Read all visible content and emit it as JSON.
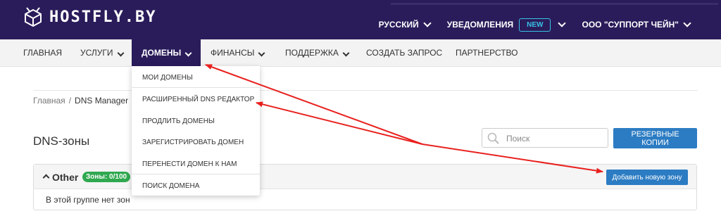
{
  "header": {
    "logo_text": "HOSTFLY.BY",
    "language": "РУССКИЙ",
    "notifications": "УВЕДОМЛЕНИЯ",
    "new_badge": "NEW",
    "account": "ООО \"СУППОРТ ЧЕЙН\""
  },
  "nav": {
    "items": [
      {
        "label": "ГЛАВНАЯ"
      },
      {
        "label": "УСЛУГИ"
      },
      {
        "label": "ДОМЕНЫ"
      },
      {
        "label": "ФИНАНСЫ"
      },
      {
        "label": "ПОДДЕРЖКА"
      },
      {
        "label": "СОЗДАТЬ ЗАПРОС"
      },
      {
        "label": "ПАРТНЕРСТВО"
      }
    ],
    "active": "ДОМЕНЫ"
  },
  "domains_menu": {
    "items": [
      "МОИ ДОМЕНЫ",
      "РАСШИРЕННЫЙ DNS РЕДАКТОР",
      "ПРОДЛИТЬ ДОМЕНЫ",
      "ЗАРЕГИСТРИРОВАТЬ ДОМЕН",
      "ПЕРЕНЕСТИ ДОМЕН К НАМ",
      "ПОИСК ДОМЕНА"
    ]
  },
  "breadcrumb": {
    "home": "Главная",
    "separator": "/",
    "current": "DNS Manager"
  },
  "page": {
    "title": "DNS-зоны",
    "search_placeholder": "Поиск",
    "backup_button": "РЕЗЕРВНЫЕ КОПИИ"
  },
  "group": {
    "name": "Other",
    "zones_badge": "Зоны: 0/100",
    "add_button": "Добавить новую зону",
    "empty_text": "В этой группе нет зон"
  },
  "colors": {
    "header_bg": "#2a1c5a",
    "accent_blue": "#2c7cc3",
    "badge_green": "#2fa84f",
    "new_badge": "#39c1e6",
    "arrow_red": "#e8201e"
  },
  "icons": [
    "logo-box-icon",
    "chevron-down-icon",
    "search-icon",
    "chevron-up-icon"
  ]
}
